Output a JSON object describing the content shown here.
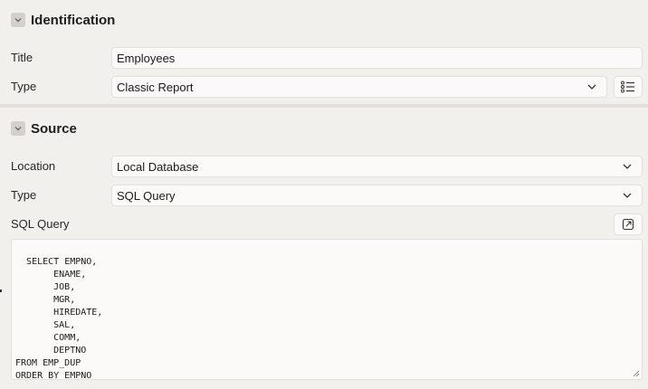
{
  "identification": {
    "title": "Identification",
    "title_label": "Title",
    "title_value": "Employees",
    "type_label": "Type",
    "type_value": "Classic Report"
  },
  "source": {
    "title": "Source",
    "location_label": "Location",
    "location_value": "Local Database",
    "type_label": "Type",
    "type_value": "SQL Query",
    "sql_label": "SQL Query",
    "sql_text": "SELECT EMPNO,\n       ENAME,\n       JOB,\n       MGR,\n       HIREDATE,\n       SAL,\n       COMM,\n       DEPTNO\nFROM EMP_DUP\nORDER BY EMPNO"
  },
  "icons": {
    "collapse": "chevron-down-icon",
    "dropdown": "chevron-down-icon",
    "list": "list-icon",
    "expand": "expand-icon",
    "resize": "resize-handle-icon"
  }
}
